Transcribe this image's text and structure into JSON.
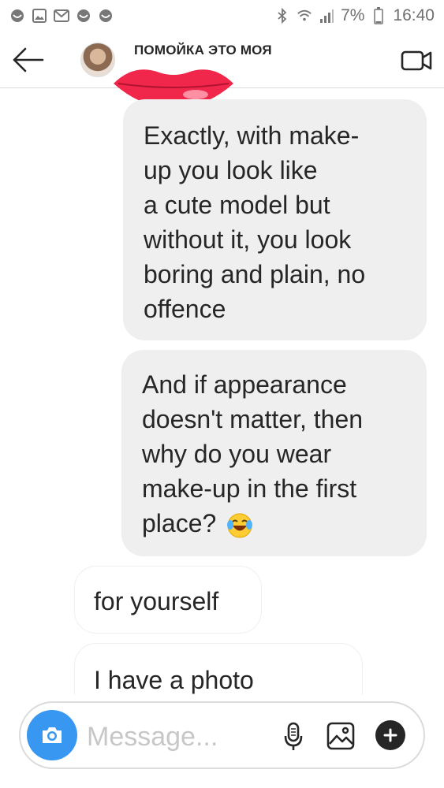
{
  "status_bar": {
    "battery": "7%",
    "time": "16:40"
  },
  "header": {
    "title": "ПОМОЙКА ЭТО МОЯ"
  },
  "messages": [
    {
      "direction": "outgoing",
      "lines": [
        "Exactly, with make-",
        "up you look like",
        "a cute model but",
        "without it, you look",
        "boring and plain, no",
        "offence"
      ]
    },
    {
      "direction": "outgoing",
      "lines": [
        "And if appearance",
        "doesn't matter, then",
        "why do you wear",
        "make-up in the first",
        "place?"
      ],
      "trailing_emoji": "face-with-tears-of-joy"
    },
    {
      "direction": "incoming",
      "lines": [
        "for yourself"
      ]
    },
    {
      "direction": "incoming",
      "lines": [
        "I have a photo"
      ]
    }
  ],
  "composer": {
    "placeholder": "Message..."
  },
  "colors": {
    "outgoing_bubble": "#efefef",
    "accent_blue": "#3897f0",
    "lips_red": "#f0264a"
  }
}
